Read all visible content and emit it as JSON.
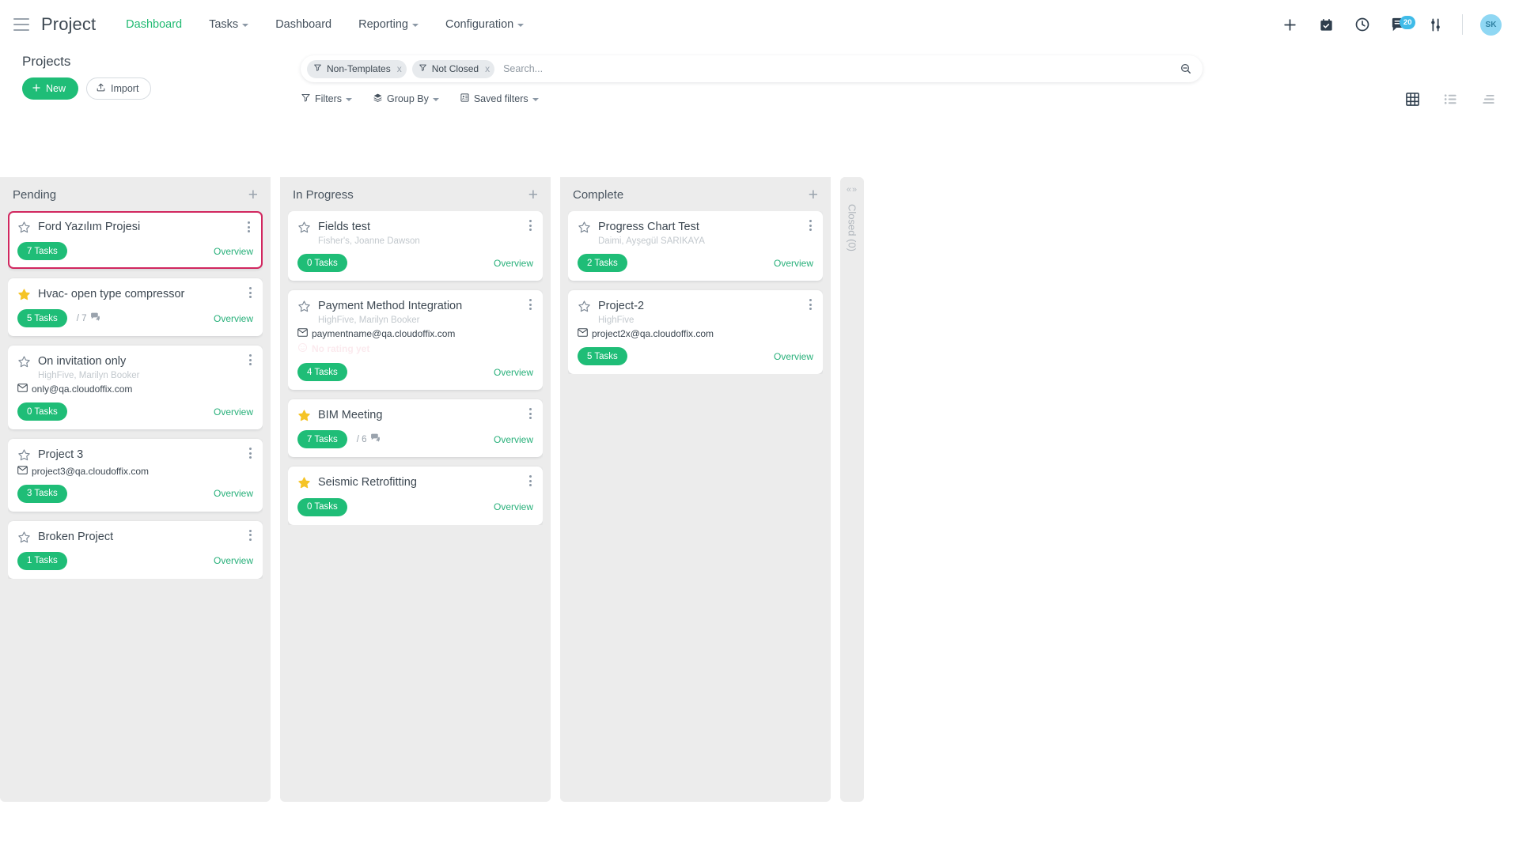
{
  "app": {
    "brand": "Project",
    "menu_icon": "hamburger-icon"
  },
  "nav": {
    "items": [
      {
        "label": "Dashboard",
        "active": true,
        "has_caret": false
      },
      {
        "label": "Tasks",
        "active": false,
        "has_caret": true
      },
      {
        "label": "Dashboard",
        "active": false,
        "has_caret": false
      },
      {
        "label": "Reporting",
        "active": false,
        "has_caret": true
      },
      {
        "label": "Configuration",
        "active": false,
        "has_caret": true
      }
    ]
  },
  "topbar_right": {
    "add_icon": "plus-icon",
    "calendar_icon": "calendar-check-icon",
    "clock_icon": "clock-icon",
    "messages_icon": "message-icon",
    "messages_badge": "20",
    "settings_icon": "sliders-icon",
    "avatar_initials": "SK"
  },
  "page": {
    "title": "Projects",
    "new_label": "New",
    "import_label": "Import"
  },
  "search": {
    "placeholder": "Search...",
    "value": "",
    "facets": [
      {
        "label": "Non-Templates",
        "remove": "x",
        "icon": "filter-icon"
      },
      {
        "label": "Not Closed",
        "remove": "x",
        "icon": "filter-icon"
      }
    ],
    "magnifier_icon": "search-minus-icon"
  },
  "filters": {
    "items": [
      {
        "label": "Filters",
        "icon": "filter-icon",
        "caret": true
      },
      {
        "label": "Group By",
        "icon": "layers-icon",
        "caret": true
      },
      {
        "label": "Saved filters",
        "icon": "saved-filter-icon",
        "caret": true
      }
    ]
  },
  "views": {
    "items": [
      {
        "name": "kanban-view",
        "icon": "grid-icon",
        "active": true
      },
      {
        "name": "list-view",
        "icon": "list-icon",
        "active": false
      },
      {
        "name": "sort-view",
        "icon": "lines-icon",
        "active": false
      }
    ]
  },
  "colors": {
    "accent_green": "#1fbd77",
    "link_green": "#28b07a",
    "nav_active": "#21ba72",
    "highlight_border": "#d1275f",
    "badge_blue": "#3fbbe8",
    "star_gold": "#f5c426",
    "column_bg": "#ececec"
  },
  "board": {
    "columns": [
      {
        "title": "Pending",
        "add_icon": "plus-icon",
        "collapsed": false,
        "cards": [
          {
            "title": "Ford Yazılım Projesi",
            "starred": false,
            "highlight": true,
            "subtitle": "",
            "email": "",
            "rating": "",
            "tasks": "7 Tasks",
            "comments": "",
            "overview": "Overview"
          },
          {
            "title": "Hvac- open type compressor",
            "starred": true,
            "highlight": false,
            "subtitle": "",
            "email": "",
            "rating": "",
            "tasks": "5 Tasks",
            "comments": "/ 7",
            "overview": "Overview"
          },
          {
            "title": "On invitation only",
            "starred": false,
            "highlight": false,
            "subtitle": "HighFive, Marilyn Booker",
            "email": "only@qa.cloudoffix.com",
            "rating": "",
            "tasks": "0 Tasks",
            "comments": "",
            "overview": "Overview"
          },
          {
            "title": "Project 3",
            "starred": false,
            "highlight": false,
            "subtitle": "",
            "email": "project3@qa.cloudoffix.com",
            "rating": "",
            "tasks": "3 Tasks",
            "comments": "",
            "overview": "Overview"
          },
          {
            "title": "Broken Project",
            "starred": false,
            "highlight": false,
            "subtitle": "",
            "email": "",
            "rating": "",
            "tasks": "1 Tasks",
            "comments": "",
            "overview": "Overview"
          }
        ]
      },
      {
        "title": "In Progress",
        "add_icon": "plus-icon",
        "collapsed": false,
        "cards": [
          {
            "title": "Fields test",
            "starred": false,
            "highlight": false,
            "subtitle": "Fisher's, Joanne Dawson",
            "email": "",
            "rating": "",
            "tasks": "0 Tasks",
            "comments": "",
            "overview": "Overview"
          },
          {
            "title": "Payment Method Integration",
            "starred": false,
            "highlight": false,
            "subtitle": "HighFive, Marilyn Booker",
            "email": "paymentname@qa.cloudoffix.com",
            "rating": "No rating yet",
            "tasks": "4 Tasks",
            "comments": "",
            "overview": "Overview"
          },
          {
            "title": "BIM Meeting",
            "starred": true,
            "highlight": false,
            "subtitle": "",
            "email": "",
            "rating": "",
            "tasks": "7 Tasks",
            "comments": "/ 6",
            "overview": "Overview"
          },
          {
            "title": "Seismic Retrofitting",
            "starred": true,
            "highlight": false,
            "subtitle": "",
            "email": "",
            "rating": "",
            "tasks": "0 Tasks",
            "comments": "",
            "overview": "Overview"
          }
        ]
      },
      {
        "title": "Complete",
        "add_icon": "plus-icon",
        "collapsed": false,
        "cards": [
          {
            "title": "Progress Chart Test",
            "starred": false,
            "highlight": false,
            "subtitle": "Daimi, Ayşegül SARIKAYA",
            "email": "",
            "rating": "",
            "tasks": "2 Tasks",
            "comments": "",
            "overview": "Overview"
          },
          {
            "title": "Project-2",
            "starred": false,
            "highlight": false,
            "subtitle": "HighFive",
            "email": "project2x@qa.cloudoffix.com",
            "rating": "",
            "tasks": "5 Tasks",
            "comments": "",
            "overview": "Overview"
          }
        ]
      },
      {
        "title": "Closed (0)",
        "collapsed": true,
        "handle": "«»",
        "cards": []
      }
    ]
  }
}
